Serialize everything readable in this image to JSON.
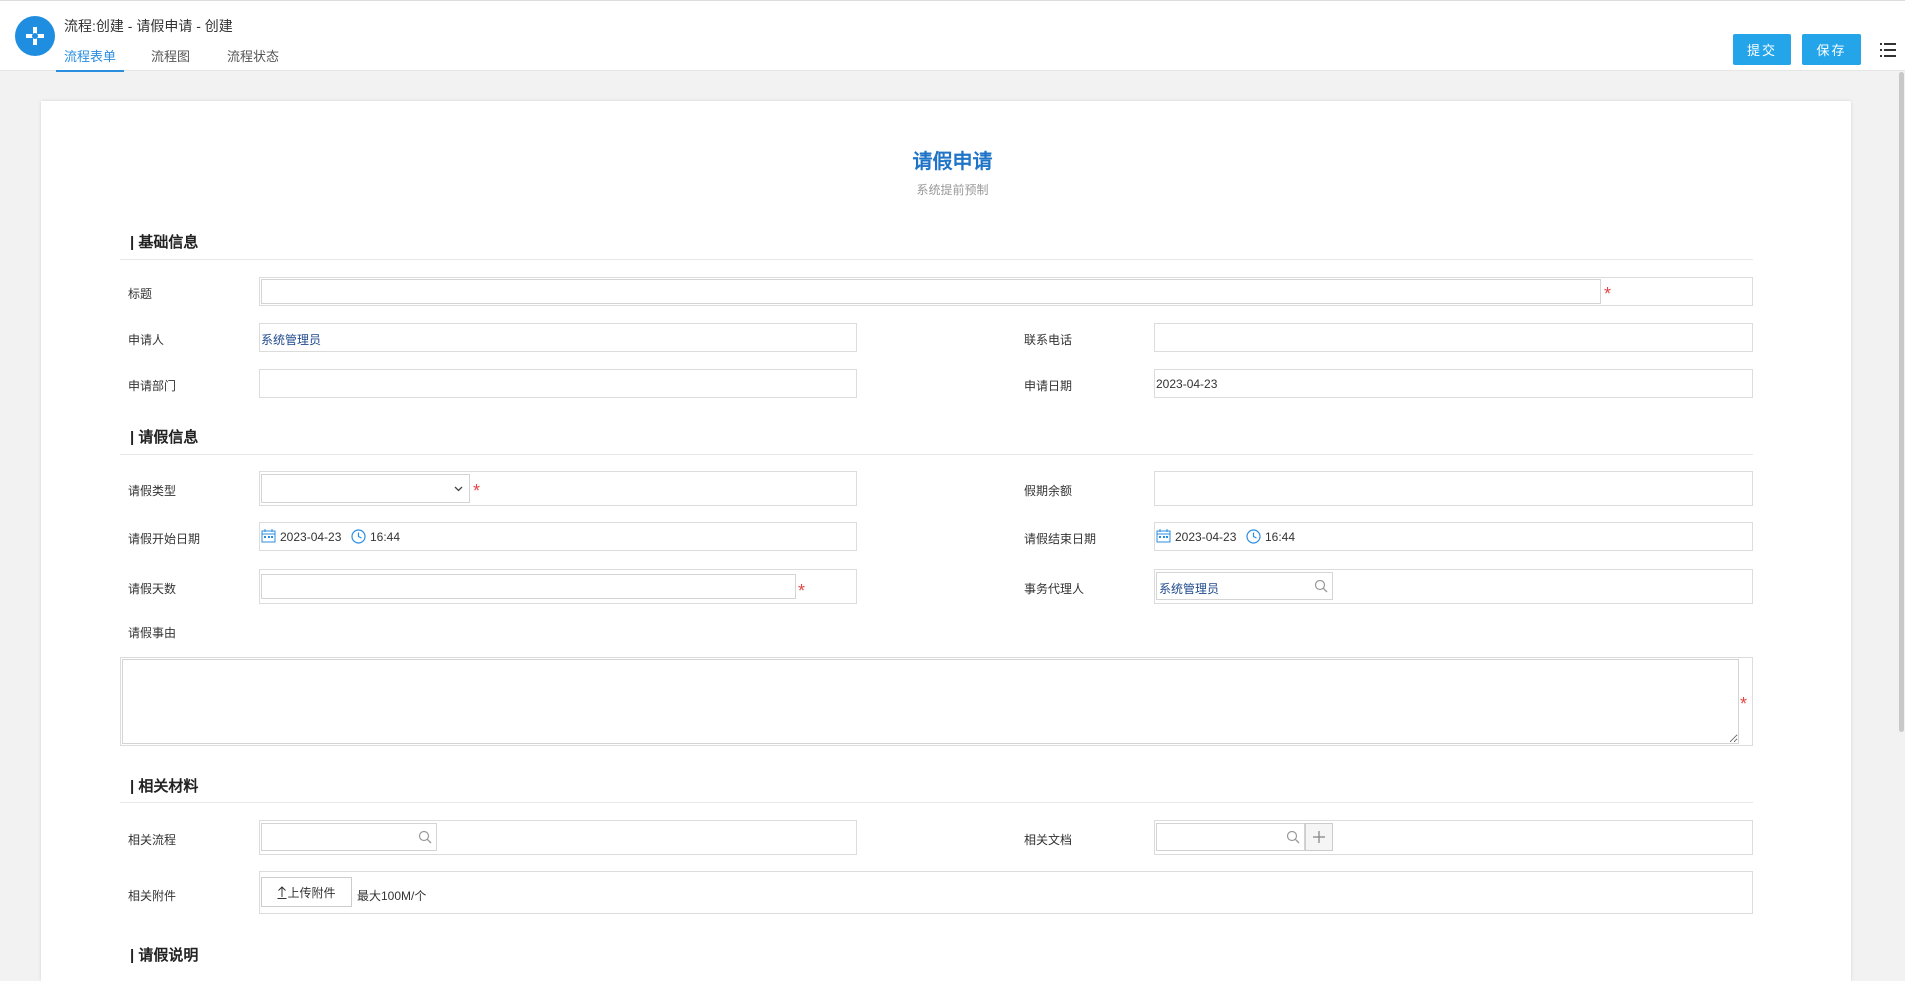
{
  "header": {
    "title": "流程:创建 - 请假申请 - 创建",
    "tabs": [
      {
        "label": "流程表单",
        "active": true
      },
      {
        "label": "流程图",
        "active": false
      },
      {
        "label": "流程状态",
        "active": false
      }
    ],
    "submit_label": "提交",
    "save_label": "保存",
    "menu_icon": "list-menu-icon"
  },
  "form": {
    "title": "请假申请",
    "subtitle": "系统提前预制",
    "sections": {
      "basic": "| 基础信息",
      "leave": "| 请假信息",
      "materials": "| 相关材料",
      "notes": "| 请假说明"
    },
    "fields": {
      "title": {
        "label": "标题",
        "value": "",
        "required": true
      },
      "applicant": {
        "label": "申请人",
        "value": "系统管理员"
      },
      "phone": {
        "label": "联系电话",
        "value": ""
      },
      "department": {
        "label": "申请部门",
        "value": ""
      },
      "apply_date": {
        "label": "申请日期",
        "value": "2023-04-23"
      },
      "leave_type": {
        "label": "请假类型",
        "value": "",
        "required": true
      },
      "balance": {
        "label": "假期余额",
        "value": ""
      },
      "start": {
        "label": "请假开始日期",
        "date": "2023-04-23",
        "time": "16:44"
      },
      "end": {
        "label": "请假结束日期",
        "date": "2023-04-23",
        "time": "16:44"
      },
      "days": {
        "label": "请假天数",
        "value": "",
        "required": true
      },
      "agent": {
        "label": "事务代理人",
        "value": "系统管理员"
      },
      "reason": {
        "label": "请假事由",
        "value": "",
        "required": true
      },
      "related_flow": {
        "label": "相关流程",
        "value": ""
      },
      "related_doc": {
        "label": "相关文档",
        "value": ""
      },
      "attachment": {
        "label": "相关附件",
        "upload_label": "上传附件",
        "hint": "最大100M/个"
      }
    },
    "required_mark": "*"
  },
  "colors": {
    "accent": "#24a5ea",
    "title_blue": "#1f74c7",
    "required_red": "#e64545"
  }
}
